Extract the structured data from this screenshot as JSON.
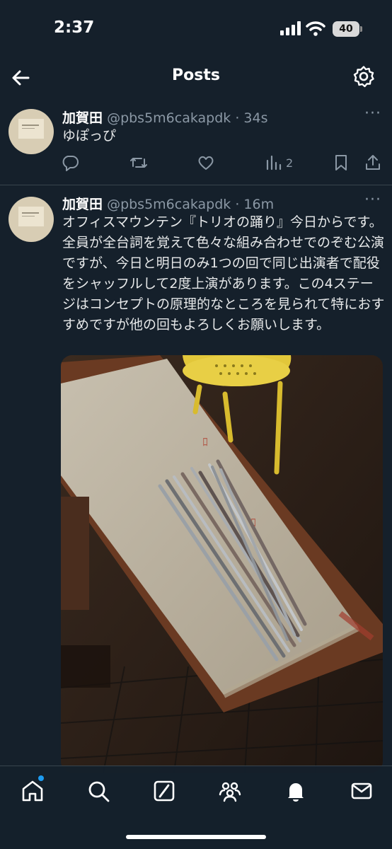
{
  "status_bar": {
    "time": "2:37",
    "battery": "40"
  },
  "header": {
    "title": "Posts"
  },
  "posts": [
    {
      "author_name": "加賀田",
      "handle": "@pbs5m6cakapdk",
      "separator": " · ",
      "age": "34s",
      "text": "ゆぽっぴ",
      "views": "2"
    },
    {
      "author_name": "加賀田",
      "handle": "@pbs5m6cakapdk",
      "separator": " · ",
      "age": "16m",
      "text": "オフィスマウンテン『トリオの踊り』今日からです。全員が全台詞を覚えて色々な組み合わせでのぞむ公演ですが、今日と明日のみ1つの回で同じ出演者で配役をシャッフルして2度上演があります。この4ステージはコンセプトの原理的なところを見られて特におすすめですが他の回もよろしくお願いします。"
    }
  ],
  "icons": {
    "back": "arrow-left-icon",
    "settings": "gear-icon",
    "reply": "reply-icon",
    "repost": "repost-icon",
    "like": "heart-icon",
    "views": "views-chart-icon",
    "bookmark": "bookmark-icon",
    "share": "share-icon",
    "more": "more-icon",
    "nav": [
      "home-icon",
      "search-icon",
      "grok-icon",
      "communities-icon",
      "notifications-icon",
      "messages-icon"
    ]
  },
  "colors": {
    "background": "#15202b",
    "secondary_text": "#8b98a5",
    "accent": "#1d9bf0",
    "divider": "#38444d"
  }
}
